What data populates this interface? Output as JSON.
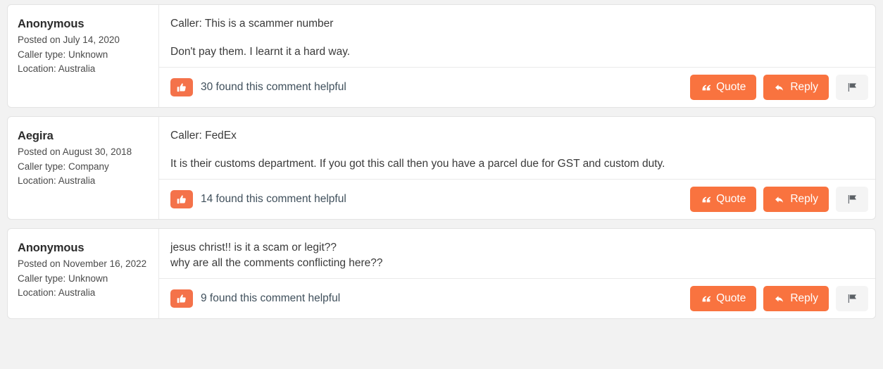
{
  "page": {
    "background_color": "#f2f2f2",
    "accent_color": "#f9733f",
    "thumb_color": "#f4724a",
    "flag_button_color": "#f4f4f4"
  },
  "labels": {
    "quote": "Quote",
    "reply": "Reply",
    "quote_icon": "quote-icon",
    "reply_icon": "reply-arrow-icon",
    "flag_icon": "flag-icon",
    "thumbs_up_icon": "thumbs-up-icon"
  },
  "comments": [
    {
      "author": "Anonymous",
      "posted": "Posted on July 14, 2020",
      "caller_type": "Caller type: Unknown",
      "location": "Location: Australia",
      "body": [
        "Caller: This is a scammer number",
        "Don't pay them. I learnt it a hard way."
      ],
      "tight_lines": false,
      "helpful_text": "30 found this comment helpful",
      "helpful_count": 30
    },
    {
      "author": "Aegira",
      "posted": "Posted on August 30, 2018",
      "caller_type": "Caller type: Company",
      "location": "Location: Australia",
      "body": [
        "Caller: FedEx",
        "It is their customs department. If you got this call then you have a parcel due for GST and custom duty."
      ],
      "tight_lines": false,
      "helpful_text": "14 found this comment helpful",
      "helpful_count": 14
    },
    {
      "author": "Anonymous",
      "posted": "Posted on November 16, 2022",
      "caller_type": "Caller type: Unknown",
      "location": "Location: Australia",
      "body": [
        "jesus christ!! is it a scam or legit??",
        "why are all the comments conflicting here??"
      ],
      "tight_lines": true,
      "helpful_text": "9 found this comment helpful",
      "helpful_count": 9
    }
  ]
}
